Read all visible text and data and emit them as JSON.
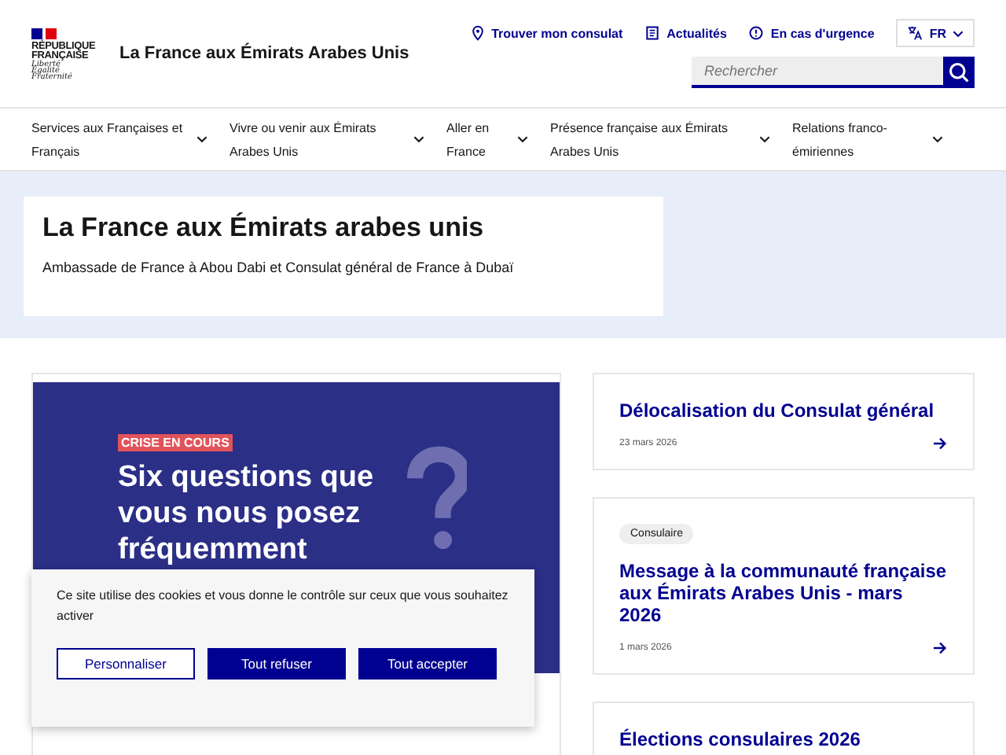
{
  "header": {
    "logo_lines": [
      "RÉPUBLIQUE",
      "FRANÇAISE"
    ],
    "motto": [
      "Liberté",
      "Égalité",
      "Fraternité"
    ],
    "site_title": "La France aux Émirats Arabes Unis",
    "quick_links": [
      {
        "kind": "pin",
        "label": "Trouver mon consulat"
      },
      {
        "kind": "news",
        "label": "Actualités"
      },
      {
        "kind": "alert",
        "label": "En cas d'urgence"
      }
    ],
    "language": "FR",
    "search": {
      "placeholder": "Rechercher"
    }
  },
  "nav": [
    {
      "label": "Services aux Françaises et Français"
    },
    {
      "label": "Vivre ou venir aux Émirats Arabes Unis"
    },
    {
      "label": "Aller en France"
    },
    {
      "label": "Présence française aux Émirats Arabes Unis"
    },
    {
      "label": "Relations franco-émiriennes"
    }
  ],
  "hero": {
    "title": "La France aux Émirats arabes unis",
    "subtitle": "Ambassade de France à Abou Dabi et Consulat général de France à Dubaï"
  },
  "featured": {
    "badge": "CRISE EN COURS",
    "headline": "Six questions que vous nous posez fréquemment"
  },
  "news": [
    {
      "title": "Délocalisation du Consulat général",
      "date": "23 mars 2026"
    },
    {
      "tag": "Consulaire",
      "title": "Message à la communauté française aux Émirats Arabes Unis - mars 2026",
      "date": "1 mars 2026"
    },
    {
      "title": "Élections consulaires 2026"
    }
  ],
  "cookie_banner": {
    "text": "Ce site utilise des cookies et vous donne le contrôle sur ceux que vous souhaitez activer",
    "buttons": [
      {
        "kind": "outline",
        "label": "Personnaliser"
      },
      {
        "kind": "filled",
        "label": "Tout refuser"
      },
      {
        "kind": "filled",
        "label": "Tout accepter"
      }
    ]
  }
}
